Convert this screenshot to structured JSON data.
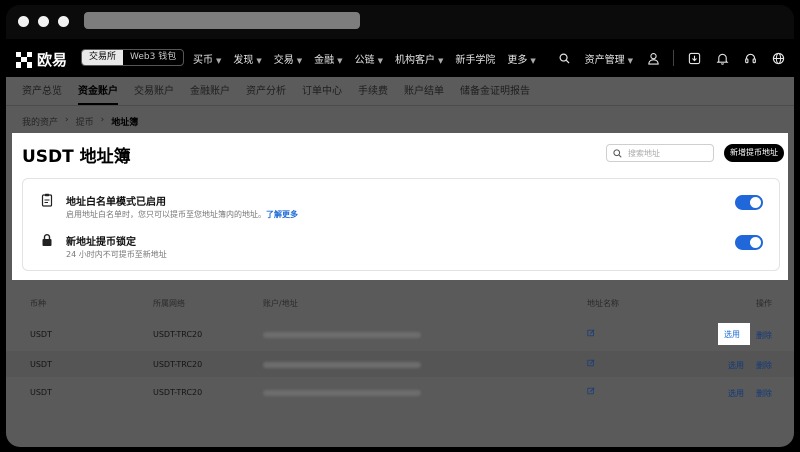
{
  "browser": {
    "dots": 3
  },
  "topnav": {
    "logo_text": "欧易",
    "segments": [
      "交易所",
      "Web3 钱包"
    ],
    "menu": [
      {
        "label": "买币",
        "has_dropdown": true
      },
      {
        "label": "发现",
        "has_dropdown": true
      },
      {
        "label": "交易",
        "has_dropdown": true
      },
      {
        "label": "金融",
        "has_dropdown": true
      },
      {
        "label": "公链",
        "has_dropdown": true
      },
      {
        "label": "机构客户",
        "has_dropdown": true
      },
      {
        "label": "新手学院",
        "has_dropdown": false
      },
      {
        "label": "更多",
        "has_dropdown": true
      }
    ],
    "asset_management": "资产管理",
    "icons": [
      "search-icon",
      "user-icon",
      "download-icon",
      "bell-icon",
      "headset-icon",
      "globe-icon"
    ]
  },
  "subtabs": [
    "资产总览",
    "资金账户",
    "交易账户",
    "金融账户",
    "资产分析",
    "订单中心",
    "手续费",
    "账户结单",
    "储备金证明报告"
  ],
  "subtabs_active": "资金账户",
  "breadcrumb": [
    "我的资产",
    "提币",
    "地址簿"
  ],
  "panel": {
    "title": "USDT 地址簿",
    "search_placeholder": "搜索地址",
    "add_button": "新增提币地址",
    "settings": [
      {
        "icon": "clipboard-icon",
        "title": "地址白名单模式已启用",
        "desc": "启用地址白名单时，您只可以提币至您地址簿内的地址。",
        "link": "了解更多",
        "enabled": true
      },
      {
        "icon": "lock-icon",
        "title": "新地址提币锁定",
        "desc": "24 小时内不可提币至新地址",
        "link": "",
        "enabled": true
      }
    ]
  },
  "table": {
    "headers": [
      "币种",
      "所属网络",
      "账户/地址",
      "地址名称",
      "操作"
    ],
    "rows": [
      {
        "coin": "USDT",
        "network": "USDT-TRC20",
        "select": "选用",
        "delete": "删除"
      },
      {
        "coin": "USDT",
        "network": "USDT-TRC20",
        "select": "选用",
        "delete": "删除"
      },
      {
        "coin": "USDT",
        "network": "USDT-TRC20",
        "select": "选用",
        "delete": "删除"
      }
    ]
  },
  "colors": {
    "accent": "#2067d9",
    "link": "#1d6bd6",
    "nav_bg": "#000000",
    "overlay": "#5a5a5a"
  }
}
